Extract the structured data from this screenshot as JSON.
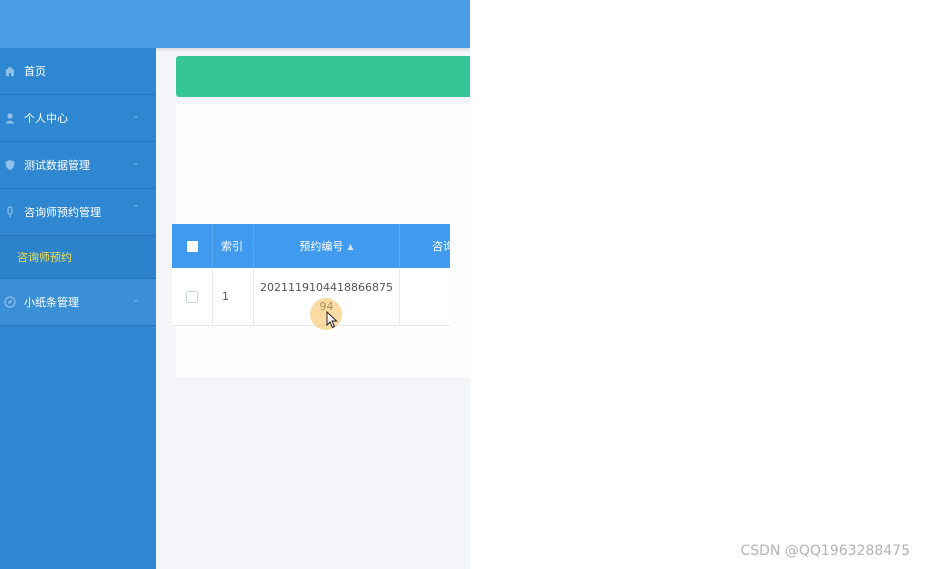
{
  "sidebar": {
    "items": [
      {
        "label": "首页",
        "icon": "home-icon"
      },
      {
        "label": "个人中心",
        "icon": "user-icon"
      },
      {
        "label": "测试数据管理",
        "icon": "shield-icon"
      },
      {
        "label": "咨询师预约管理",
        "icon": "microphone-icon"
      },
      {
        "label": "小纸条管理",
        "icon": "compass-icon"
      }
    ],
    "sub_item": "咨询师预约"
  },
  "table": {
    "headers": [
      "索引",
      "预约编号",
      "咨询"
    ],
    "row": {
      "index": "1",
      "code": "2021119104418866875 94"
    }
  },
  "watermark": "CSDN @QQ1963288475",
  "colors": {
    "sidebar": "#2f87d1",
    "topbar": "#4a9ee8",
    "banner": "#35c597",
    "table_header": "#3f9af0",
    "active_sub": "#f4e04d"
  }
}
